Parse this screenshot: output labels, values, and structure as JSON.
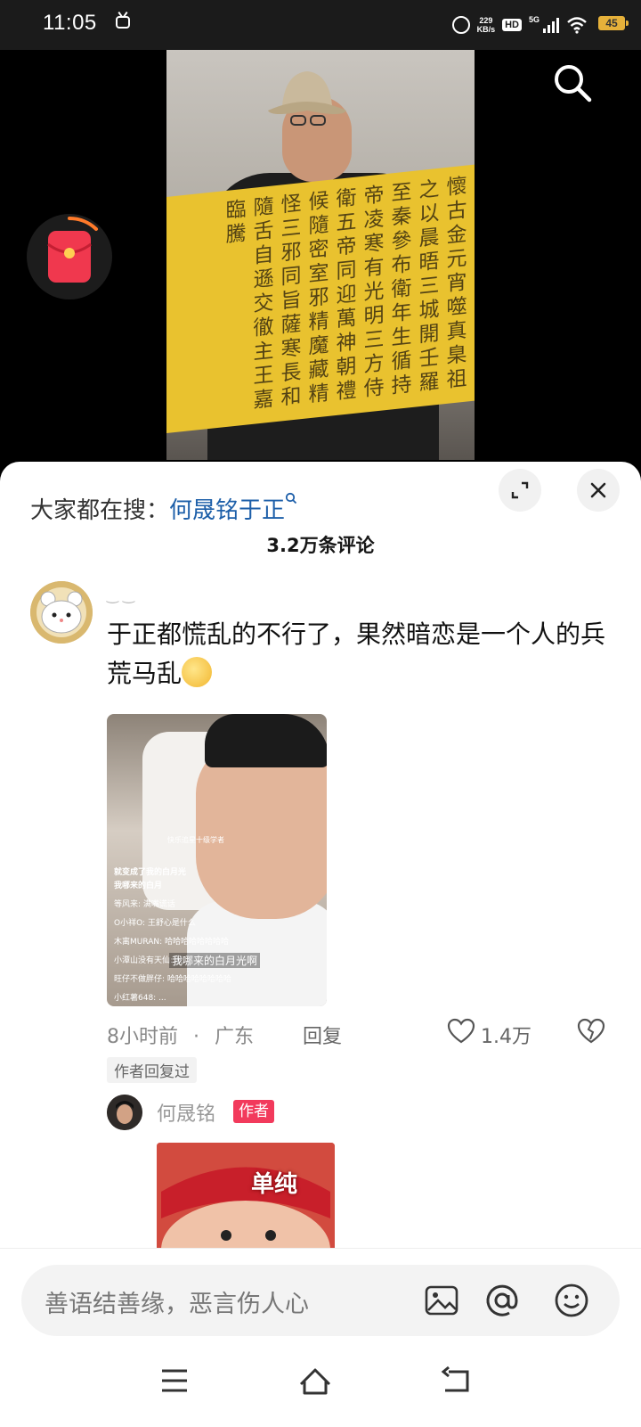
{
  "status_bar": {
    "time": "11:05",
    "net_speed_value": "229",
    "net_speed_unit": "KB/s",
    "hd_label": "HD",
    "network": "5G",
    "battery": "45"
  },
  "video": {
    "calligraphy_text": "懷古金元宵噬真臬祖之以晨晤三城開壬羅至秦參布衛年生循持帝凌寒有光明三方侍衛五帝同迎萬神朝禮候隨密室邪精魔藏精怪三邪同旨薩寒長和隨舌自遜交徹主王嘉臨騰"
  },
  "search_suggest": {
    "label": "大家都在搜：",
    "term": "何晟铭于正"
  },
  "comments_count": "3.2万条评论",
  "comment": {
    "username": "‿ ‿",
    "text": "于正都慌乱的不行了，果然暗恋是一个人的兵荒马乱",
    "image_overlay": {
      "line1": "快乐追星十级学者",
      "line2a": "就变成了我的白月光",
      "line2b": "我哪来的白月",
      "danmaku": [
        "等风来: 满嘴谎话",
        "O小祥O: 王舒心是什么",
        "木离MURAN: 哈哈哈哈哈哈哈哈",
        "小潭山没有天仙: 我...",
        "旺仔不做胖仔: 哈哈哈哈哈哈哈哈",
        "小红薯648: ..."
      ],
      "subtitle": "我哪来的白月光啊"
    },
    "time": "8小时前",
    "location": "广东",
    "reply_label": "回复",
    "likes": "1.4万",
    "tag": "作者回复过",
    "reply": {
      "username": "何晟铭",
      "badge": "作者",
      "image_text": "单纯"
    }
  },
  "input": {
    "placeholder": "善语结善缘，恶言伤人心"
  }
}
